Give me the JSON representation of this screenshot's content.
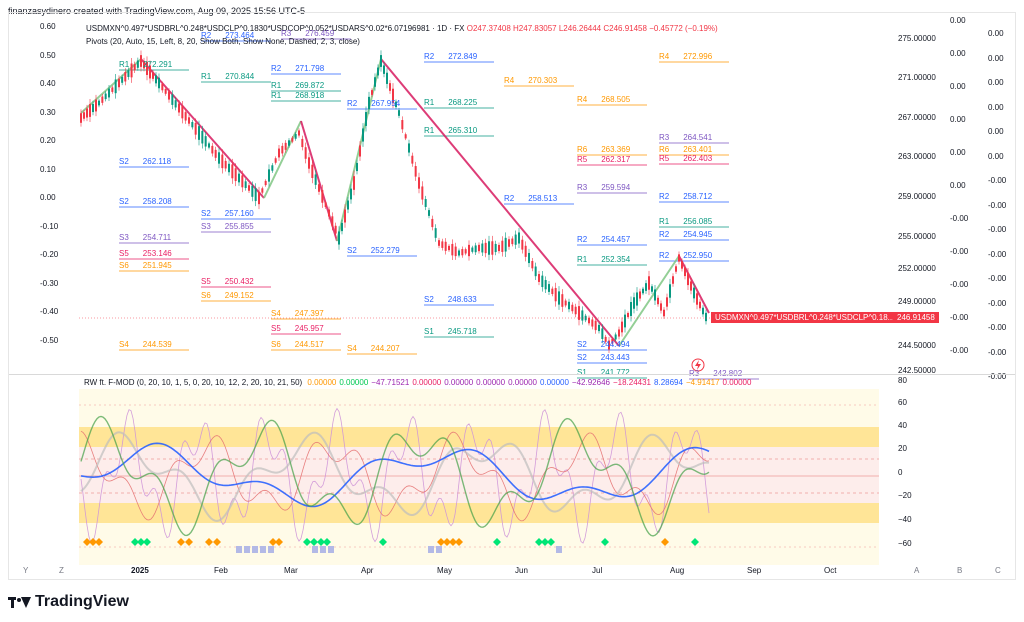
{
  "header": {
    "text": "finanzasydinero created with TradingView.com, Aug 09, 2025 15:56 UTC-5"
  },
  "symbol": {
    "title": "USDMXN^0.497*USDBRL^0.248*USDCLP^0.1830*USDCOP^0.052*USDARS^0.02*6.07196981 · 1D · FX",
    "open": "O247.37408",
    "high": "H247.83057",
    "low": "L246.26444",
    "close": "C246.91458",
    "change": "−0.45772 (−0.19%)",
    "up_color": "#089981",
    "down_color": "#f23645"
  },
  "pivots_legend": "Pivots (20, Auto, 15, Left, 8, 20, Show Both, Show None, Dashed, 2, 3, close)",
  "price_axis": [
    "275.00000",
    "271.00000",
    "267.00000",
    "263.00000",
    "259.00000",
    "255.00000",
    "252.00000",
    "249.00000",
    "244.50000",
    "242.50000"
  ],
  "left_axis": [
    "0.60",
    "0.50",
    "0.40",
    "0.30",
    "0.20",
    "0.10",
    "0.00",
    "-0.10",
    "-0.20",
    "-0.30",
    "-0.40",
    "-0.50"
  ],
  "right_axis_inner": [
    "0.00",
    "0.00",
    "0.00",
    "0.00",
    "0.00",
    "0.00",
    "-0.00",
    "-0.00",
    "-0.00",
    "-0.00",
    "-0.00"
  ],
  "right_axis_outer": [
    "0.00",
    "0.00",
    "0.00",
    "0.00",
    "0.00",
    "0.00",
    "-0.00",
    "-0.00",
    "-0.00",
    "-0.00",
    "-0.00",
    "-0.00",
    "-0.00",
    "-0.00",
    "-0.00"
  ],
  "current_price": {
    "label": "USDMXN^0.497*USDBRL^0.248*USDCLP^0.18...",
    "value": "246.91458"
  },
  "pivot_labels": [
    {
      "t": "R3",
      "v": "276.459",
      "c": "#7e57c2"
    },
    {
      "t": "R2",
      "v": "273.464",
      "c": "#2962ff"
    },
    {
      "t": "R1",
      "v": "272.291",
      "c": "#089981"
    },
    {
      "t": "R2",
      "v": "271.798",
      "c": "#2962ff"
    },
    {
      "t": "R1",
      "v": "270.844",
      "c": "#089981"
    },
    {
      "t": "R1",
      "v": "269.872",
      "c": "#089981"
    },
    {
      "t": "R1",
      "v": "268.918",
      "c": "#089981"
    },
    {
      "t": "R2",
      "v": "267.954",
      "c": "#2962ff"
    },
    {
      "t": "R1",
      "v": "268.225",
      "c": "#089981"
    },
    {
      "t": "R2",
      "v": "272.849",
      "c": "#2962ff"
    },
    {
      "t": "R4",
      "v": "270.303",
      "c": "#ff9800"
    },
    {
      "t": "R4",
      "v": "268.505",
      "c": "#ff9800"
    },
    {
      "t": "R4",
      "v": "272.996",
      "c": "#ff9800"
    },
    {
      "t": "R1",
      "v": "265.310",
      "c": "#089981"
    },
    {
      "t": "R3",
      "v": "264.541",
      "c": "#7e57c2"
    },
    {
      "t": "R6",
      "v": "263.401",
      "c": "#ff9800"
    },
    {
      "t": "R5",
      "v": "262.403",
      "c": "#e91e63"
    },
    {
      "t": "R5",
      "v": "262.317",
      "c": "#e91e63"
    },
    {
      "t": "R6",
      "v": "263.369",
      "c": "#ff9800"
    },
    {
      "t": "S2",
      "v": "262.118",
      "c": "#2962ff"
    },
    {
      "t": "S2",
      "v": "258.208",
      "c": "#2962ff"
    },
    {
      "t": "R3",
      "v": "259.594",
      "c": "#7e57c2"
    },
    {
      "t": "R2",
      "v": "258.513",
      "c": "#2962ff"
    },
    {
      "t": "R2",
      "v": "258.712",
      "c": "#2962ff"
    },
    {
      "t": "S2",
      "v": "257.160",
      "c": "#2962ff"
    },
    {
      "t": "S3",
      "v": "255.855",
      "c": "#7e57c2"
    },
    {
      "t": "S3",
      "v": "254.711",
      "c": "#7e57c2"
    },
    {
      "t": "S5",
      "v": "253.146",
      "c": "#e91e63"
    },
    {
      "t": "S6",
      "v": "251.945",
      "c": "#ff9800"
    },
    {
      "t": "S2",
      "v": "252.279",
      "c": "#2962ff"
    },
    {
      "t": "R2",
      "v": "254.457",
      "c": "#2962ff"
    },
    {
      "t": "R1",
      "v": "256.085",
      "c": "#089981"
    },
    {
      "t": "R2",
      "v": "254.945",
      "c": "#2962ff"
    },
    {
      "t": "R2",
      "v": "252.950",
      "c": "#2962ff"
    },
    {
      "t": "R1",
      "v": "252.354",
      "c": "#089981"
    },
    {
      "t": "S5",
      "v": "250.432",
      "c": "#e91e63"
    },
    {
      "t": "S6",
      "v": "249.152",
      "c": "#ff9800"
    },
    {
      "t": "S2",
      "v": "248.633",
      "c": "#2962ff"
    },
    {
      "t": "S4",
      "v": "247.397",
      "c": "#ff9800"
    },
    {
      "t": "S5",
      "v": "245.957",
      "c": "#e91e63"
    },
    {
      "t": "S1",
      "v": "245.718",
      "c": "#089981"
    },
    {
      "t": "S4",
      "v": "244.539",
      "c": "#ff9800"
    },
    {
      "t": "S6",
      "v": "244.517",
      "c": "#ff9800"
    },
    {
      "t": "S4",
      "v": "244.207",
      "c": "#ff9800"
    },
    {
      "t": "S2",
      "v": "244.494",
      "c": "#2962ff"
    },
    {
      "t": "S2",
      "v": "243.443",
      "c": "#2962ff"
    },
    {
      "t": "S1",
      "v": "241.772",
      "c": "#089981"
    },
    {
      "t": "R3",
      "v": "242.802",
      "c": "#7e57c2"
    }
  ],
  "oscillator": {
    "legend_name": "RW ft. F-MOD (0, 20, 10, 1, 5, 0, 20, 10, 12, 2, 20, 10, 21, 50)",
    "values": [
      {
        "v": "0.00000",
        "c": "#ff9800"
      },
      {
        "v": "0.00000",
        "c": "#00c853"
      },
      {
        "v": "−47.71521",
        "c": "#9c27b0"
      },
      {
        "v": "0.00000",
        "c": "#e91e63"
      },
      {
        "v": "0.00000",
        "c": "#9c27b0"
      },
      {
        "v": "0.00000",
        "c": "#9c27b0"
      },
      {
        "v": "0.00000",
        "c": "#9c27b0"
      },
      {
        "v": "0.00000",
        "c": "#2962ff"
      },
      {
        "v": "−42.92646",
        "c": "#9c27b0"
      },
      {
        "v": "−18.24431",
        "c": "#e91e63"
      },
      {
        "v": "8.28694",
        "c": "#2962ff"
      },
      {
        "v": "−4.91417",
        "c": "#ff9800"
      },
      {
        "v": "0.00000",
        "c": "#e91e63"
      }
    ],
    "axis": [
      "80",
      "60",
      "40",
      "20",
      "0",
      "−20",
      "−40",
      "−60"
    ]
  },
  "xaxis": {
    "months": [
      "2025",
      "Feb",
      "Mar",
      "Apr",
      "May",
      "Jun",
      "Jul",
      "Aug",
      "Sep",
      "Oct"
    ],
    "left_letters": [
      "Y",
      "Z"
    ],
    "right_letters": [
      "A",
      "B",
      "C"
    ]
  },
  "brand": "TradingView"
}
